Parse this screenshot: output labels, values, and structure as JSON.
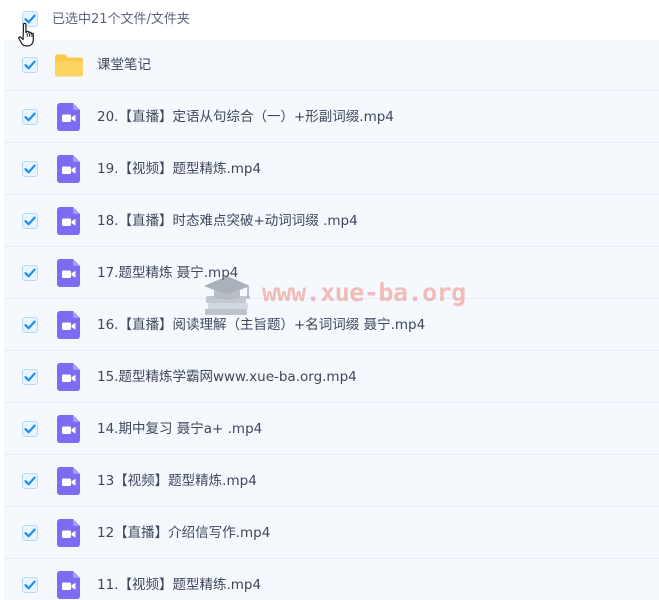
{
  "header": {
    "selection_text": "已选中21个文件/文件夹",
    "select_all_checked": true
  },
  "watermark": {
    "text": "www.xue-ba.org"
  },
  "files": [
    {
      "name": "课堂笔记",
      "type": "folder",
      "checked": true
    },
    {
      "name": "20.【直播】定语从句综合（一）+形副词缀.mp4",
      "type": "video",
      "checked": true
    },
    {
      "name": "19.【视频】题型精炼.mp4",
      "type": "video",
      "checked": true
    },
    {
      "name": "18.【直播】时态难点突破+动词词缀 .mp4",
      "type": "video",
      "checked": true
    },
    {
      "name": "17.题型精炼 聂宁.mp4",
      "type": "video",
      "checked": true
    },
    {
      "name": "16.【直播】阅读理解（主旨题）+名词词缀 聂宁.mp4",
      "type": "video",
      "checked": true
    },
    {
      "name": "15.题型精炼学霸网www.xue-ba.org.mp4",
      "type": "video",
      "checked": true
    },
    {
      "name": "14.期中复习 聂宁a+ .mp4",
      "type": "video",
      "checked": true
    },
    {
      "name": "13【视频】题型精炼.mp4",
      "type": "video",
      "checked": true
    },
    {
      "name": "12【直播】介绍信写作.mp4",
      "type": "video",
      "checked": true
    },
    {
      "name": "11.【视频】题型精练.mp4",
      "type": "video",
      "checked": true
    }
  ],
  "colors": {
    "checkmark": "#1f8cf0",
    "video_icon": "#7d6bf2",
    "folder_icon": "#fcc94a",
    "row_background": "#f5f9fe",
    "row_divider": "#e4ecf7"
  },
  "icons": {
    "checkbox": "checkbox-icon",
    "folder": "folder-icon",
    "video": "video-file-icon",
    "cursor": "hand-cursor-icon"
  }
}
